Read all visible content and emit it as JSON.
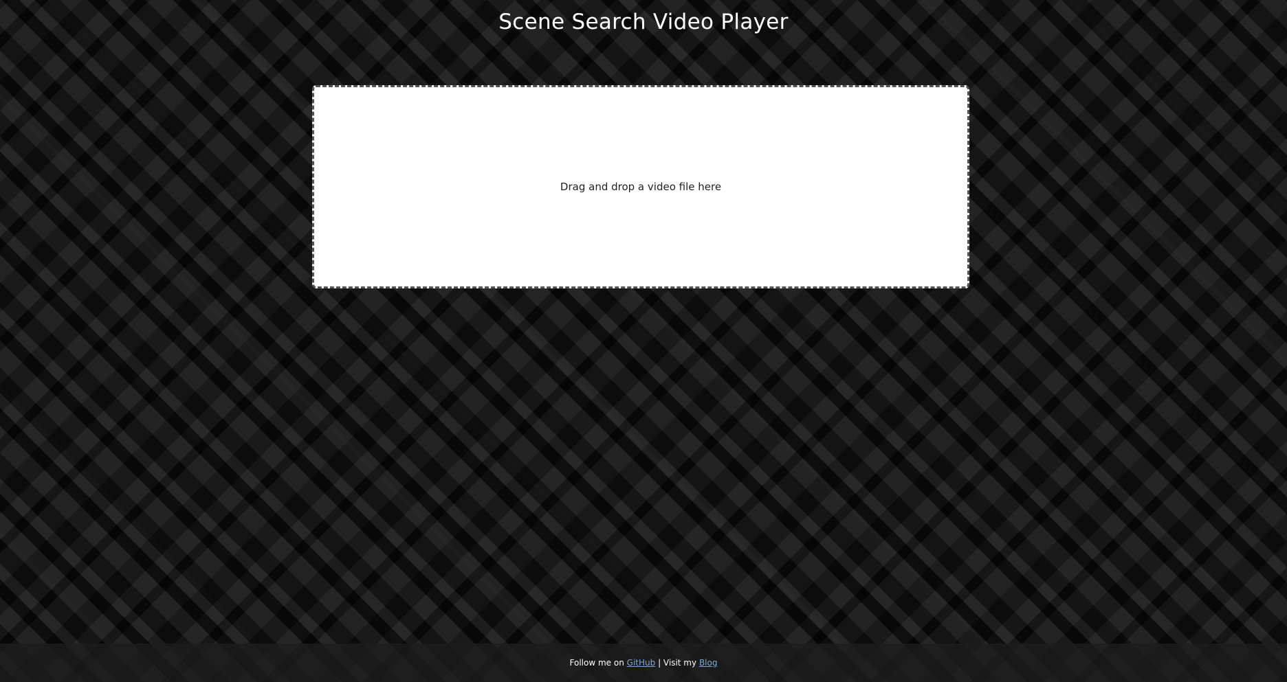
{
  "header": {
    "title": "Scene Search Video Player"
  },
  "drop_zone": {
    "text": "Drag and drop a video file here"
  },
  "footer": {
    "follow_text": "Follow me on",
    "github_label": "GitHub",
    "separator_text": "| Visit my",
    "blog_label": "Blog"
  },
  "colors": {
    "background": "#1a1a1a",
    "title": "#ffffff",
    "drop_zone_bg": "#ffffff",
    "link": "#7fa8d8"
  }
}
